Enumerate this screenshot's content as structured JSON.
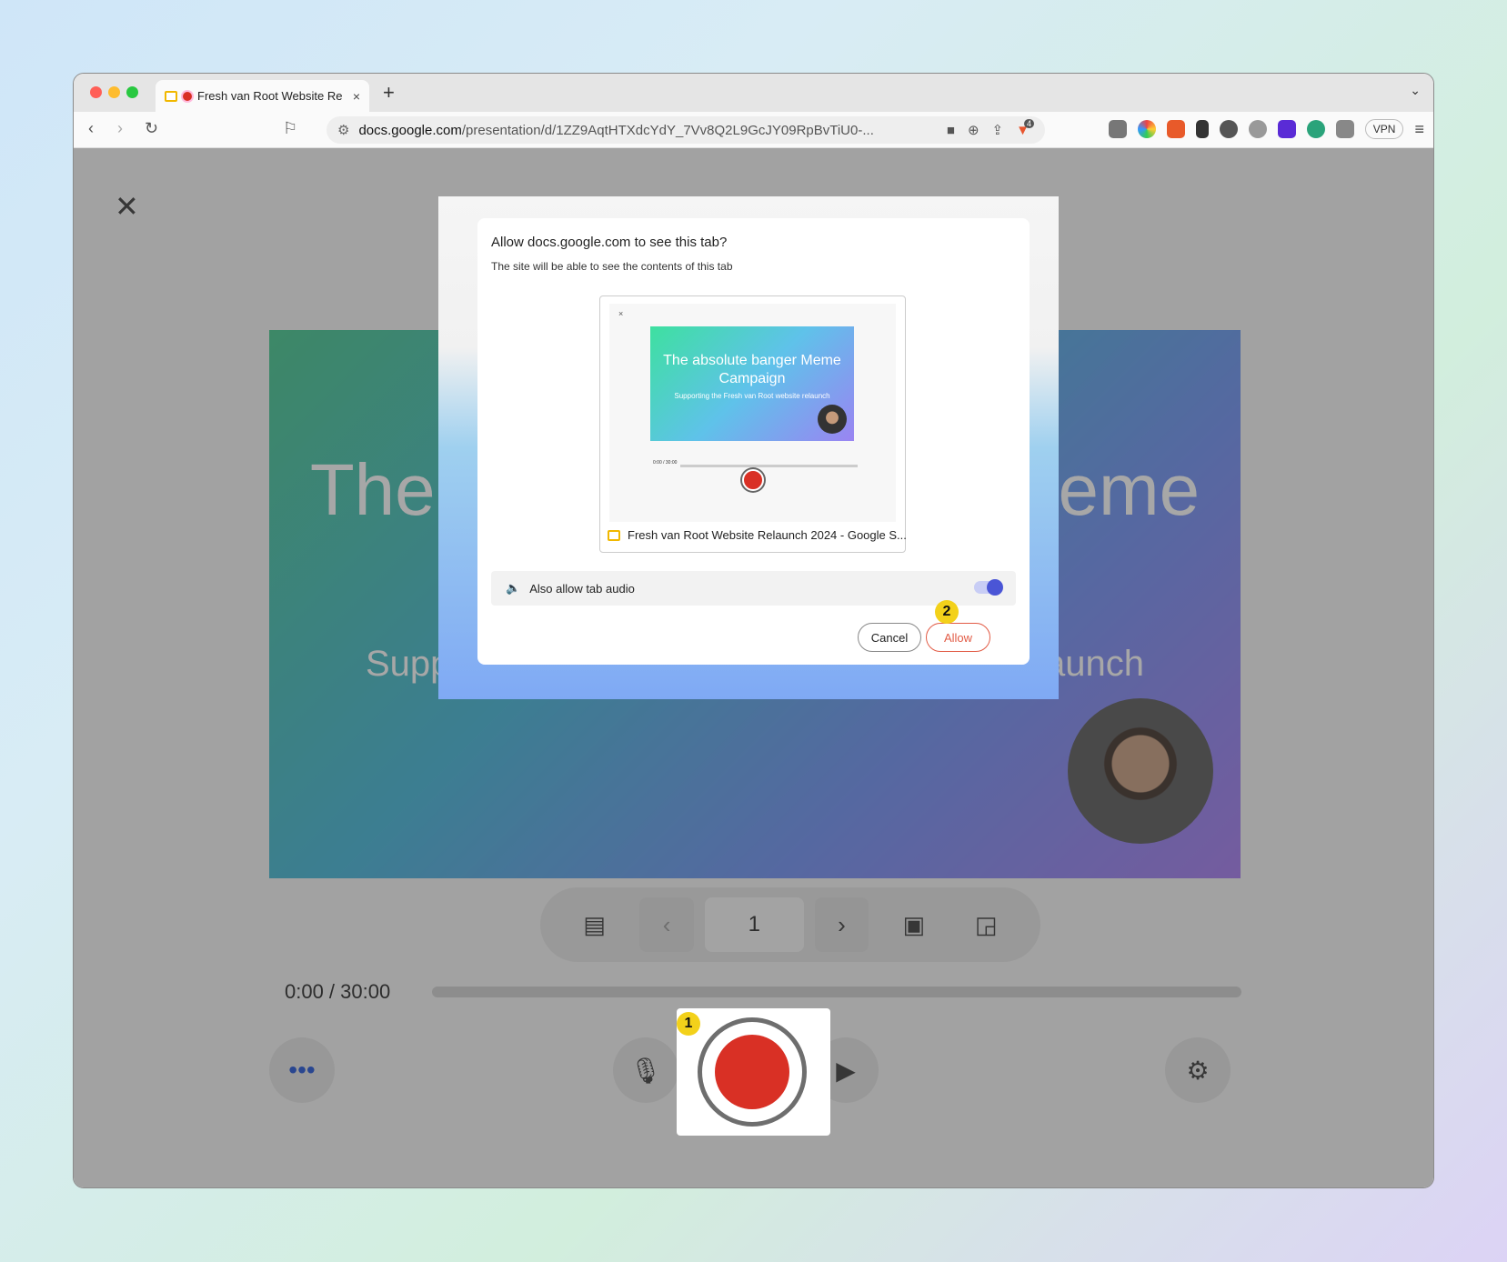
{
  "browser": {
    "tab_title": "Fresh van Root Website Re",
    "tab_close": "×",
    "new_tab": "+",
    "url_host": "docs.google.com",
    "url_path": "/presentation/d/1ZZ9AqtHTXdcYdY_7Vv8Q2L9GcJY09RpBvTiU0-...",
    "vpn_label": "VPN",
    "extension_badge": "4"
  },
  "slide": {
    "title": "The absolute banger Meme Campaign",
    "subtitle": "Supporting the Fresh van Root website relaunch"
  },
  "controls": {
    "page_number": "1",
    "time": "0:00 / 30:00"
  },
  "dialog": {
    "title": "Allow docs.google.com to see this tab?",
    "subtitle": "The site will be able to see the contents of this tab",
    "preview_tab_title": "Fresh van Root Website Relaunch 2024 - Google S...",
    "mini_slide_title": "The absolute banger Meme Campaign",
    "mini_slide_subtitle": "Supporting the Fresh van Root website relaunch",
    "mini_time": "0:00 / 30:00",
    "audio_label": "Also allow tab audio",
    "audio_enabled": true,
    "cancel_label": "Cancel",
    "allow_label": "Allow"
  },
  "badges": {
    "record": "1",
    "allow": "2"
  },
  "colors": {
    "record_red": "#d93025",
    "allow_orange": "#e25b45",
    "toggle_blue": "#4a55d6",
    "badge_yellow": "#f3d11a"
  }
}
